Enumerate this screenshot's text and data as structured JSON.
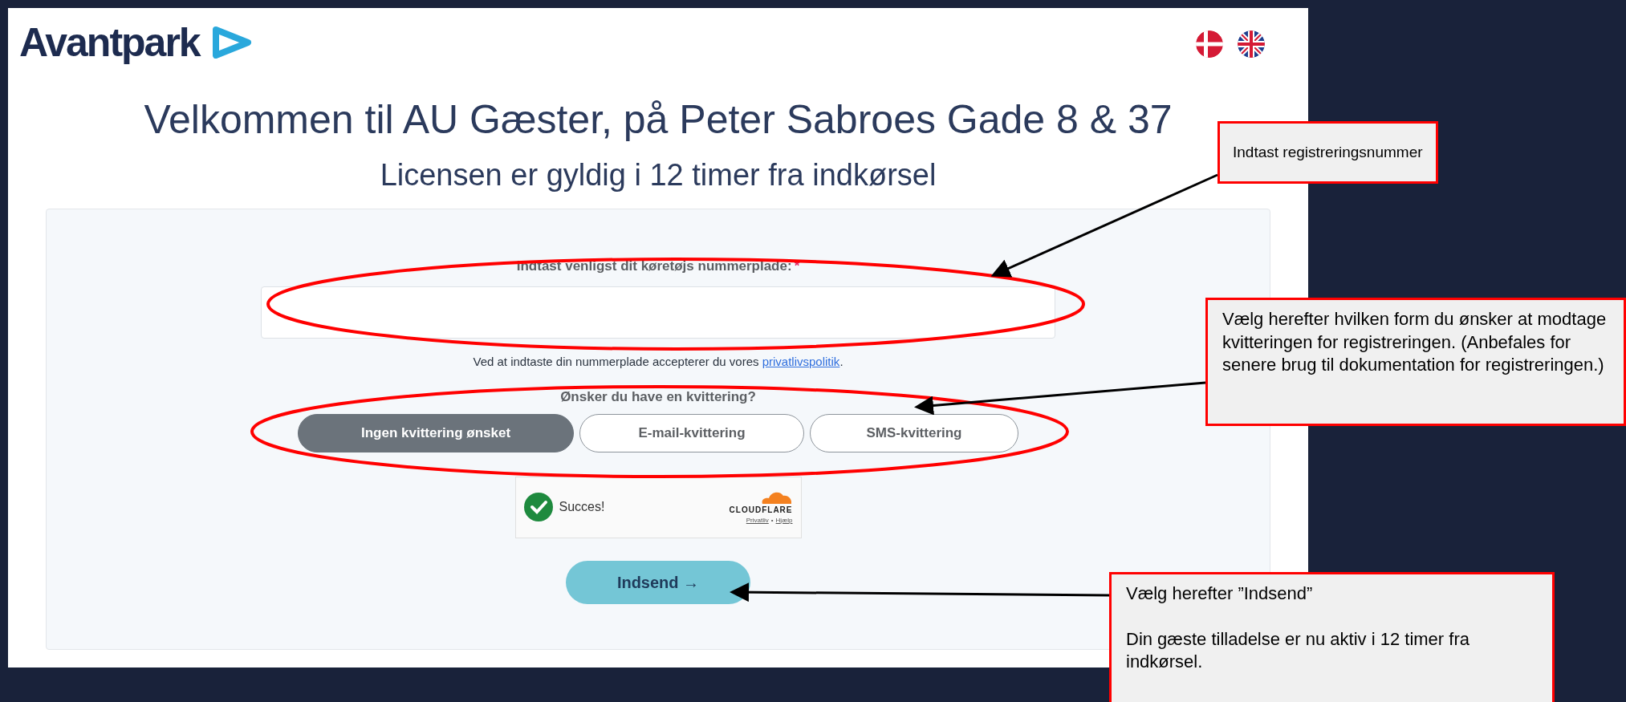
{
  "header": {
    "logo": "Avantpark",
    "languages": [
      {
        "kind": "danish"
      },
      {
        "kind": "english"
      }
    ]
  },
  "title": "Velkommen til AU Gæster, på Peter Sabroes Gade 8 & 37",
  "subtitle": "Licensen er gyldig i 12 timer fra indkørsel",
  "form": {
    "plate_label": "Indtast venligst dit køretøjs nummerplade:",
    "required_mark": "*",
    "consent": {
      "text": "Ved at indtaste din nummerplade accepterer du vores ",
      "link": "privatlivspolitik",
      "end": "."
    },
    "receipt_question": "Ønsker du have en kvittering?",
    "receipt_options": [
      {
        "label": "Ingen kvittering ønsket",
        "selected": true
      },
      {
        "label": "E-mail-kvittering",
        "selected": false
      },
      {
        "label": "SMS-kvittering",
        "selected": false
      }
    ],
    "captcha": {
      "status": "Succes!",
      "brand": "CLOUDFLARE",
      "links": [
        "Privatliv",
        "Hjælp"
      ],
      "separator": "•"
    },
    "submit": {
      "label": "Indsend",
      "arrow": "→"
    }
  },
  "annotations": [
    {
      "text": "Indtast registreringsnummer"
    },
    {
      "text": "Vælg herefter hvilken form du ønsker at modtage kvitteringen for registreringen. (Anbefales for senere brug til dokumentation for registreringen.)"
    },
    {
      "text": "Vælg herefter ”Indsend”",
      "note": "Din gæste tilladelse er nu aktiv i 12 timer fra indkørsel."
    }
  ]
}
